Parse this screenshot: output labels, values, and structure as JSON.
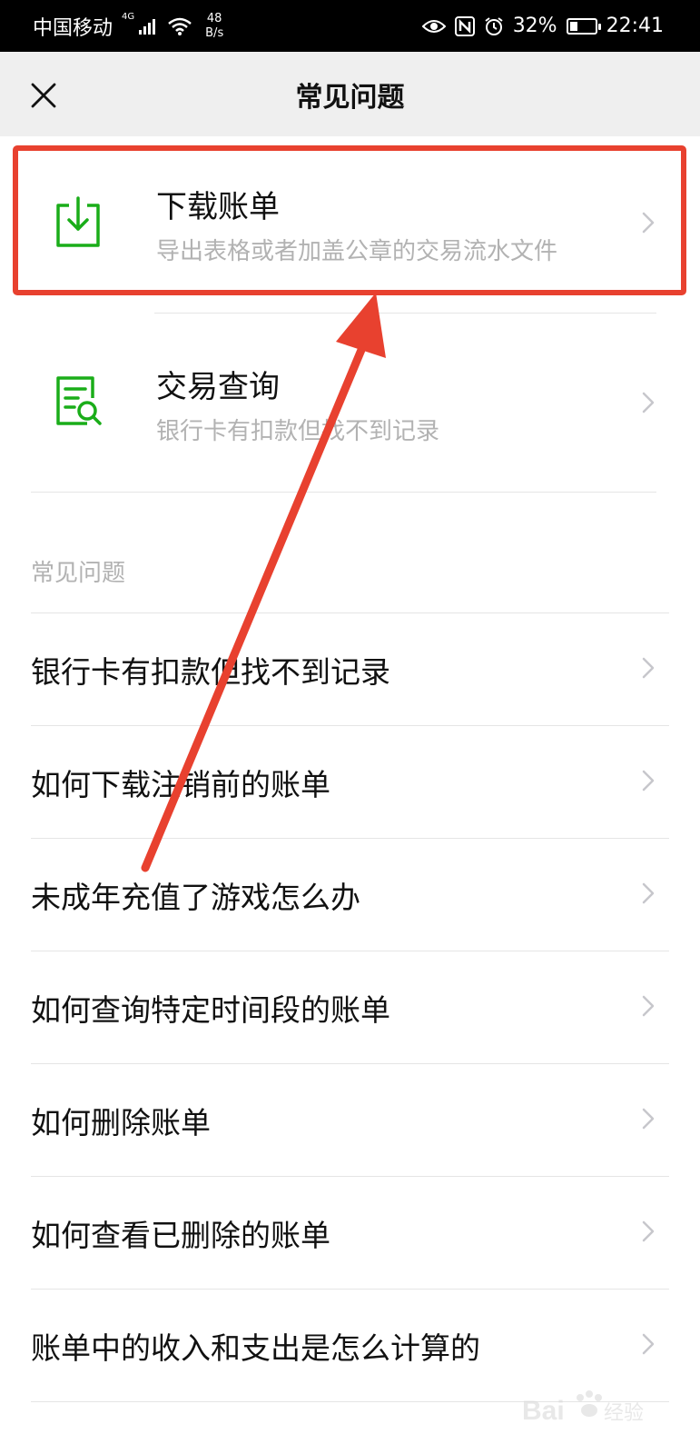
{
  "status_bar": {
    "carrier": "中国移动",
    "network_type": "4G",
    "speed_value": "48",
    "speed_unit": "B/s",
    "battery": "32%",
    "time": "22:41"
  },
  "nav": {
    "title": "常见问题"
  },
  "services": [
    {
      "title": "下载账单",
      "description": "导出表格或者加盖公章的交易流水文件",
      "icon": "download-icon"
    },
    {
      "title": "交易查询",
      "description": "银行卡有扣款但找不到记录",
      "icon": "document-search-icon"
    }
  ],
  "faq": {
    "section_title": "常见问题",
    "items": [
      "银行卡有扣款但找不到记录",
      "如何下载注销前的账单",
      "未成年充值了游戏怎么办",
      "如何查询特定时间段的账单",
      "如何删除账单",
      "如何查看已删除的账单",
      "账单中的收入和支出是怎么计算的"
    ]
  },
  "colors": {
    "accent_green": "#1aad19",
    "highlight_red": "#e8412f",
    "nav_background": "#efefef",
    "secondary_text": "#b2b2b2"
  },
  "watermark": "Baidu经验"
}
